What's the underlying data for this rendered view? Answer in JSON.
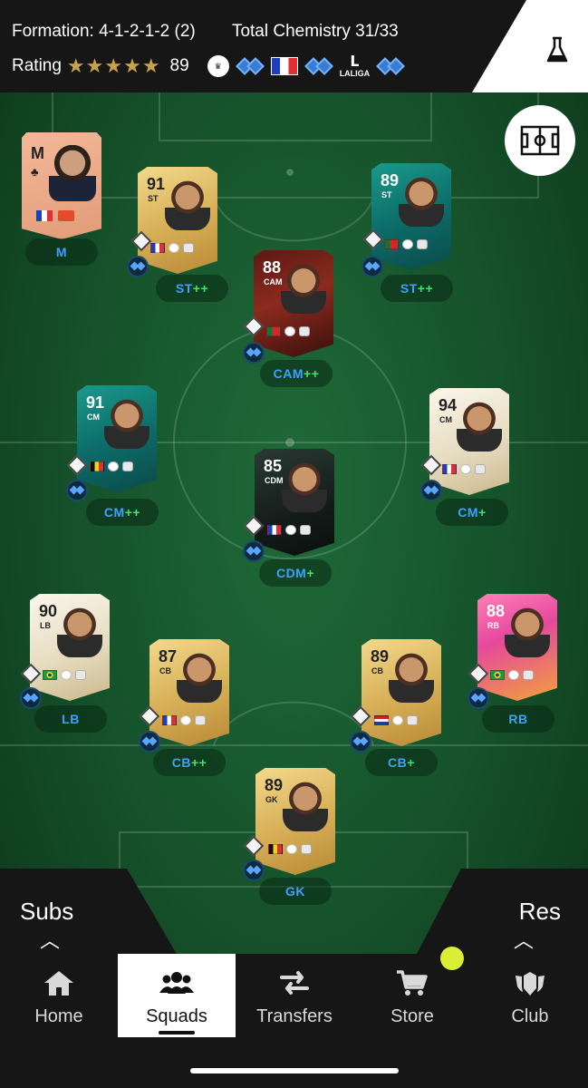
{
  "header": {
    "formation_label": "Formation: 4-1-2-1-2 (2)",
    "chemistry_label": "Total Chemistry 31/33",
    "rating_label": "Rating",
    "stars": "★★★★★",
    "rating_value": "89",
    "chem_links": [
      "premier-league-badge",
      "chem-diamond",
      "flag-france",
      "chem-diamond",
      "laliga-badge",
      "chem-diamond"
    ],
    "laliga_text": "LALIGA"
  },
  "icons": {
    "lab": "flask-icon",
    "formation": "pitch-icon"
  },
  "manager": {
    "rating": "M",
    "role": "M",
    "nation": "france"
  },
  "players": {
    "st_left": {
      "rating": "91",
      "pos": "ST",
      "role": "ST",
      "plus": "++",
      "nation": "france"
    },
    "st_right": {
      "rating": "89",
      "pos": "ST",
      "role": "ST",
      "plus": "++",
      "nation": "portugal"
    },
    "cam": {
      "rating": "88",
      "pos": "CAM",
      "role": "CAM",
      "plus": "++",
      "nation": "portugal"
    },
    "cm_left": {
      "rating": "91",
      "pos": "CM",
      "role": "CM",
      "plus": "++",
      "nation": "belgium"
    },
    "cm_right": {
      "rating": "94",
      "pos": "CM",
      "role": "CM",
      "plus": "+",
      "nation": "france"
    },
    "cdm": {
      "rating": "85",
      "pos": "CDM",
      "role": "CDM",
      "plus": "+",
      "nation": "france"
    },
    "lb": {
      "rating": "90",
      "pos": "LB",
      "role": "LB",
      "plus": "",
      "nation": "brazil"
    },
    "cb_left": {
      "rating": "87",
      "pos": "CB",
      "role": "CB",
      "plus": "++",
      "nation": "france"
    },
    "cb_right": {
      "rating": "89",
      "pos": "CB",
      "role": "CB",
      "plus": "+",
      "nation": "netherlands"
    },
    "rb": {
      "rating": "88",
      "pos": "RB",
      "role": "RB",
      "plus": "",
      "nation": "brazil"
    },
    "gk": {
      "rating": "89",
      "pos": "GK",
      "role": "GK",
      "plus": "",
      "nation": "belgium"
    }
  },
  "bench": {
    "subs_label": "Subs",
    "res_label": "Res"
  },
  "nav": {
    "items": [
      {
        "label": "Home",
        "icon": "home-icon"
      },
      {
        "label": "Squads",
        "icon": "squads-icon"
      },
      {
        "label": "Transfers",
        "icon": "transfers-icon"
      },
      {
        "label": "Store",
        "icon": "store-icon"
      },
      {
        "label": "Club",
        "icon": "club-icon"
      }
    ],
    "active": "Squads"
  },
  "colors": {
    "pitch": "#15502a",
    "bar": "#161616",
    "role_text": "#3ea0ff",
    "plus_text": "#46e070",
    "gold_star": "#c8a24a",
    "notification": "#d9ee35"
  }
}
